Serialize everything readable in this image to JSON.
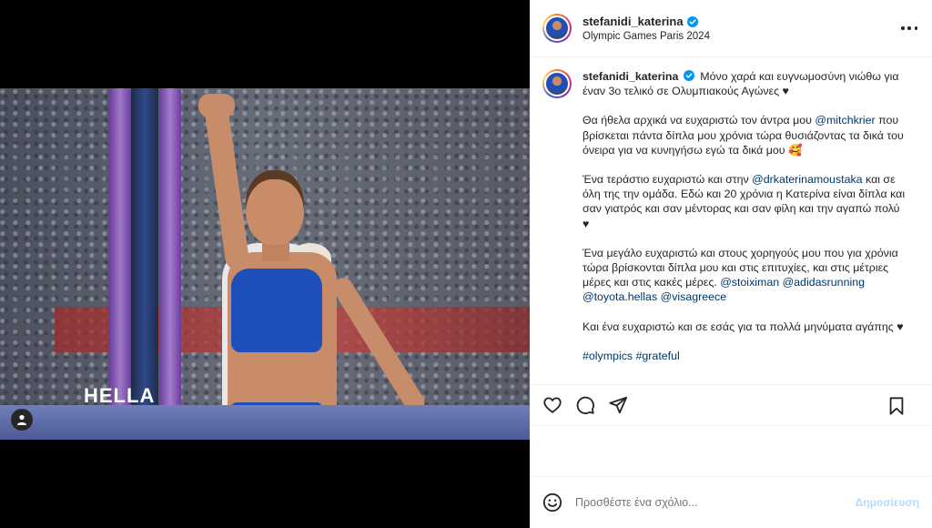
{
  "post": {
    "username": "stefanidi_katerina",
    "location": "Olympic Games Paris 2024",
    "photo_tag_text": "HELLA",
    "caption": {
      "p1": "Μόνο χαρά και ευγνωμοσύνη νιώθω για έναν 3ο τελικό σε Ολυμπιακούς Αγώνες ♥",
      "p2_a": "Θα ήθελα αρχικά να ευχαριστώ τον άντρα μου ",
      "p2_m": "@mitchkrier",
      "p2_b": " που βρίσκεται πάντα δίπλα μου χρόνια τώρα θυσιάζοντας τα δικά του όνειρα για να κυνηγήσω εγώ τα δικά μου 🥰",
      "p3_a": "Ένα τεράστιο ευχαριστώ και στην ",
      "p3_m": "@drkaterinamoustaka",
      "p3_b": " και σε όλη της την ομάδα. Εδώ και 20 χρόνια η Κατερίνα είναι δίπλα και σαν γιατρός και σαν μέντορας και σαν φίλη και την αγαπώ πολύ ♥",
      "p4_a": "Ένα μεγάλο ευχαριστώ και στους χορηγούς μου που για χρόνια τώρα βρίσκονται δίπλα μου και στις επιτυχίες, και στις μέτριες μέρες και στις κακές μέρες. ",
      "p4_m1": "@stoiximan",
      "p4_m2": "@adidasrunning",
      "p4_m3": "@toyota.hellas",
      "p4_m4": "@visagreece",
      "p5": "Και ένα ευχαριστώ και σε εσάς για τα πολλά μηνύματα αγάπης ♥",
      "tags": "#olympics #grateful"
    }
  },
  "comment": {
    "placeholder": "Προσθέστε ένα σχόλιο...",
    "post_label": "Δημοσίευση"
  },
  "colors": {
    "verified": "#0095f6",
    "mention": "#00376b",
    "post_disabled": "#b3dbff"
  }
}
